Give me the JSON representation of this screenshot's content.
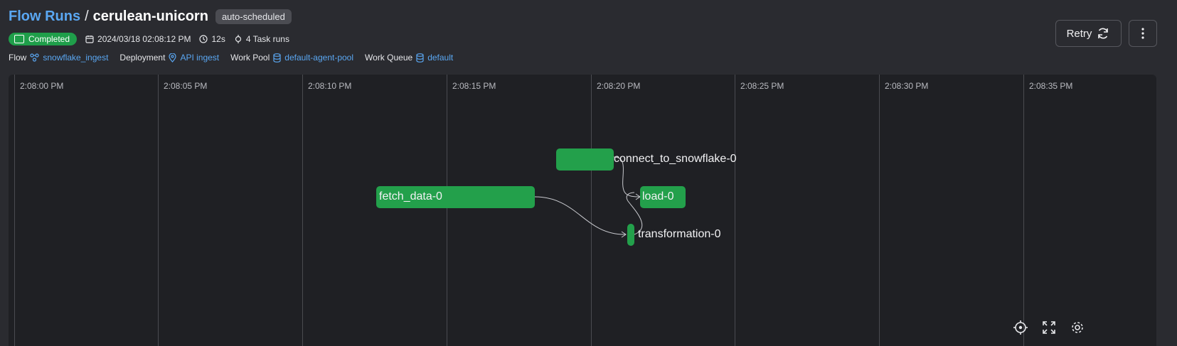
{
  "breadcrumb": {
    "parent": "Flow Runs",
    "separator": "/",
    "current": "cerulean-unicorn"
  },
  "tag": "auto-scheduled",
  "status": {
    "label": "Completed",
    "color": "#1f9e4a"
  },
  "meta": {
    "start_time": "2024/03/18 02:08:12 PM",
    "duration": "12s",
    "task_runs": "4 Task runs"
  },
  "details": {
    "flow_label": "Flow",
    "flow_value": "snowflake_ingest",
    "deployment_label": "Deployment",
    "deployment_value": "API ingest",
    "work_pool_label": "Work Pool",
    "work_pool_value": "default-agent-pool",
    "work_queue_label": "Work Queue",
    "work_queue_value": "default"
  },
  "actions": {
    "retry_label": "Retry"
  },
  "timeline": {
    "ticks": [
      "2:08:00 PM",
      "2:08:05 PM",
      "2:08:10 PM",
      "2:08:15 PM",
      "2:08:20 PM",
      "2:08:25 PM",
      "2:08:30 PM",
      "2:08:35 PM"
    ],
    "tasks": [
      {
        "name": "connect_to_snowflake-0"
      },
      {
        "name": "fetch_data-0"
      },
      {
        "name": "load-0"
      },
      {
        "name": "transformation-0"
      }
    ]
  },
  "colors": {
    "accent": "#5aa7f2",
    "success": "#23a04b",
    "background": "#1f2024"
  },
  "icons": [
    "calendar-icon",
    "clock-icon",
    "task-icon",
    "flow-icon",
    "location-icon",
    "database-icon",
    "refresh-icon",
    "more-vertical-icon",
    "crosshair-icon",
    "fullscreen-icon",
    "gear-icon"
  ]
}
